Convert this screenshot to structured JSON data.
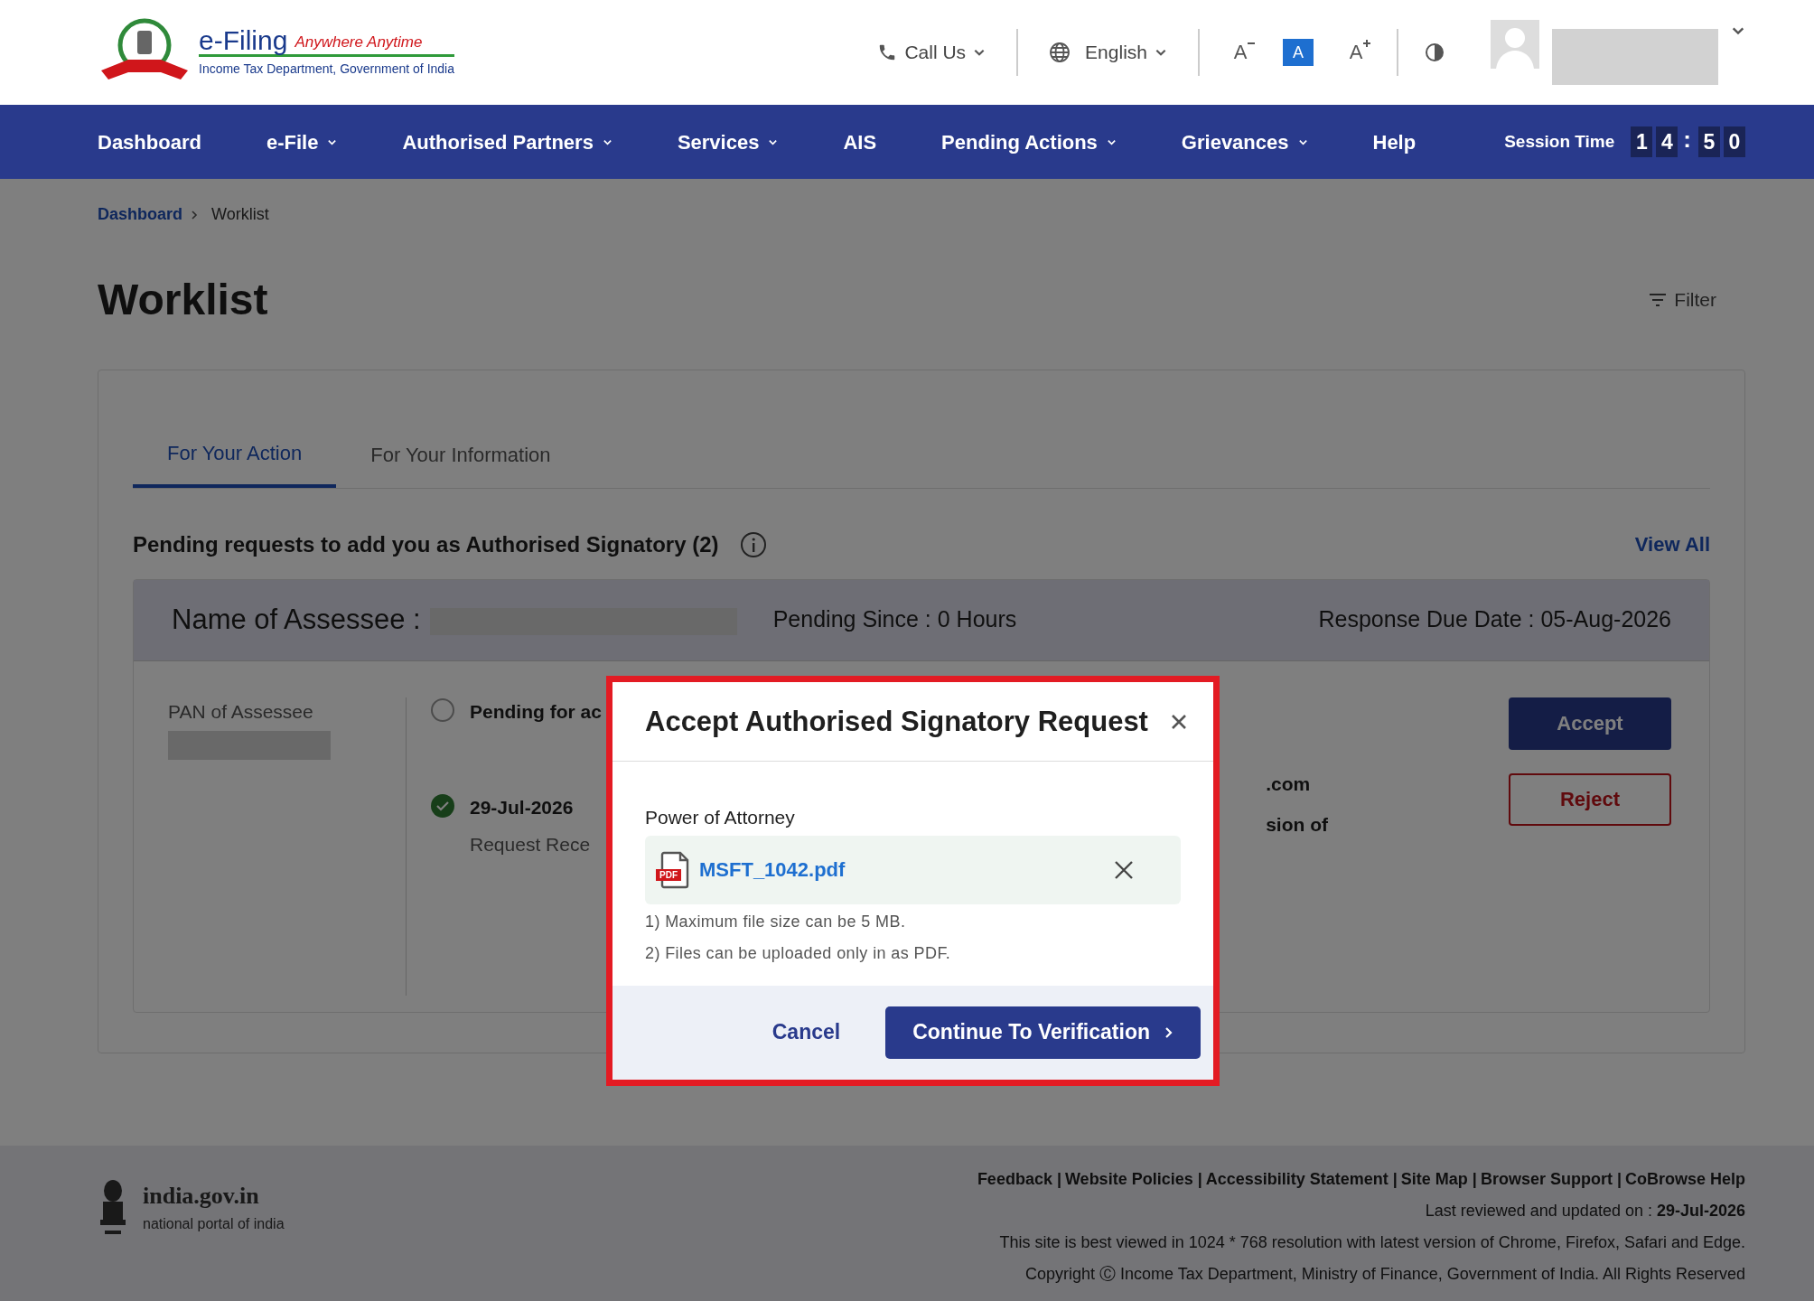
{
  "header": {
    "logo": {
      "title": "e-Filing",
      "tagline": "Anywhere Anytime",
      "subtitle": "Income Tax Department, Government of India"
    },
    "call_us": "Call Us",
    "language": "English",
    "font_controls": [
      {
        "label": "A",
        "kind": "decrease",
        "selected": false
      },
      {
        "label": "A",
        "kind": "normal",
        "selected": true
      },
      {
        "label": "A",
        "kind": "increase",
        "selected": false
      }
    ]
  },
  "nav": {
    "items": [
      {
        "label": "Dashboard",
        "dropdown": false
      },
      {
        "label": "e-File",
        "dropdown": true
      },
      {
        "label": "Authorised Partners",
        "dropdown": true
      },
      {
        "label": "Services",
        "dropdown": true
      },
      {
        "label": "AIS",
        "dropdown": false
      },
      {
        "label": "Pending Actions",
        "dropdown": true
      },
      {
        "label": "Grievances",
        "dropdown": true
      },
      {
        "label": "Help",
        "dropdown": false
      }
    ],
    "session_label": "Session Time",
    "session_time": [
      {
        "text": "1",
        "kind": "digit"
      },
      {
        "text": "4",
        "kind": "digit"
      },
      {
        "text": ":",
        "kind": "separator"
      },
      {
        "text": "5",
        "kind": "digit"
      },
      {
        "text": "0",
        "kind": "digit"
      }
    ]
  },
  "breadcrumb": [
    {
      "label": "Dashboard",
      "link": true
    },
    {
      "label": "Worklist",
      "link": false
    }
  ],
  "page_title": "Worklist",
  "filter": "Filter",
  "tabs": [
    {
      "label": "For Your Action",
      "selected": true
    },
    {
      "label": "For Your Information",
      "selected": false
    }
  ],
  "section": {
    "heading": "Pending requests to add you as Authorised Signatory (2)",
    "view_all": "View All"
  },
  "request": {
    "name_label": "Name of Assessee :",
    "pending_since": "Pending Since : 0 Hours",
    "due_date": "Response Due Date : 05-Aug-2026",
    "pan_label": "PAN of Assessee",
    "timeline": [
      {
        "title": "Pending for ac",
        "done": false
      },
      {
        "title": "29-Jul-2026",
        "subtitle": "Request Rece",
        "done": true
      }
    ],
    "column_3": [
      ".com",
      "sion of"
    ],
    "buttons": [
      "Accept",
      "Reject"
    ]
  },
  "modal": {
    "title": "Accept Authorised Signatory Request",
    "field_label": "Power of Attorney",
    "file_name": "MSFT_1042.pdf",
    "file_badge": "PDF",
    "notes": [
      "1) Maximum file size can be 5 MB.",
      "2) Files can be uploaded only in as PDF."
    ],
    "cancel": "Cancel",
    "continue": "Continue To Verification"
  },
  "footer": {
    "portal_name": "india.gov.in",
    "portal_tagline": "national portal of india",
    "links": [
      "Feedback |",
      "Website Policies |",
      "Accessibility Statement |",
      "Site Map |",
      "Browser Support |",
      "CoBrowse Help"
    ],
    "last_reviewed": "Last reviewed and updated on : **29-Jul-2026**",
    "best_viewed": "This site is best viewed in 1024 * 768 resolution with latest version of Chrome, Firefox, Safari and Edge.",
    "copyright": "Copyright Ⓒ Income Tax Department, Ministry of Finance, Government of India. All Rights Reserved"
  }
}
